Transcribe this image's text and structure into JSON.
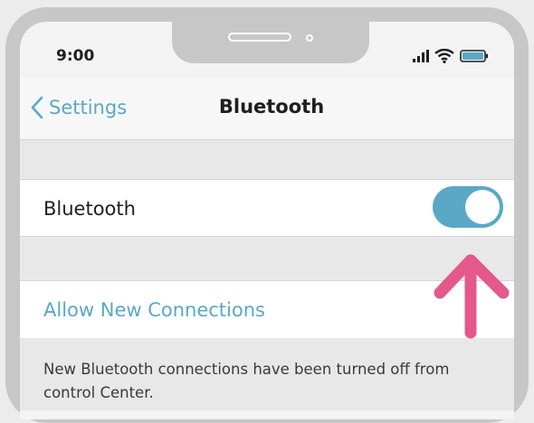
{
  "status_bar": {
    "time": "9:00",
    "icons": [
      "signal-icon",
      "wifi-icon",
      "battery-icon"
    ]
  },
  "nav": {
    "back_label": "Settings",
    "title": "Bluetooth"
  },
  "bluetooth_row": {
    "label": "Bluetooth",
    "toggle_on": true
  },
  "connections_row": {
    "label": "Allow New Connections"
  },
  "footer": {
    "note": "New Bluetooth connections have been turned off from control Center."
  },
  "colors": {
    "accent": "#5aa8c6",
    "arrow": "#e4588a",
    "frame": "#c7c7c7"
  }
}
